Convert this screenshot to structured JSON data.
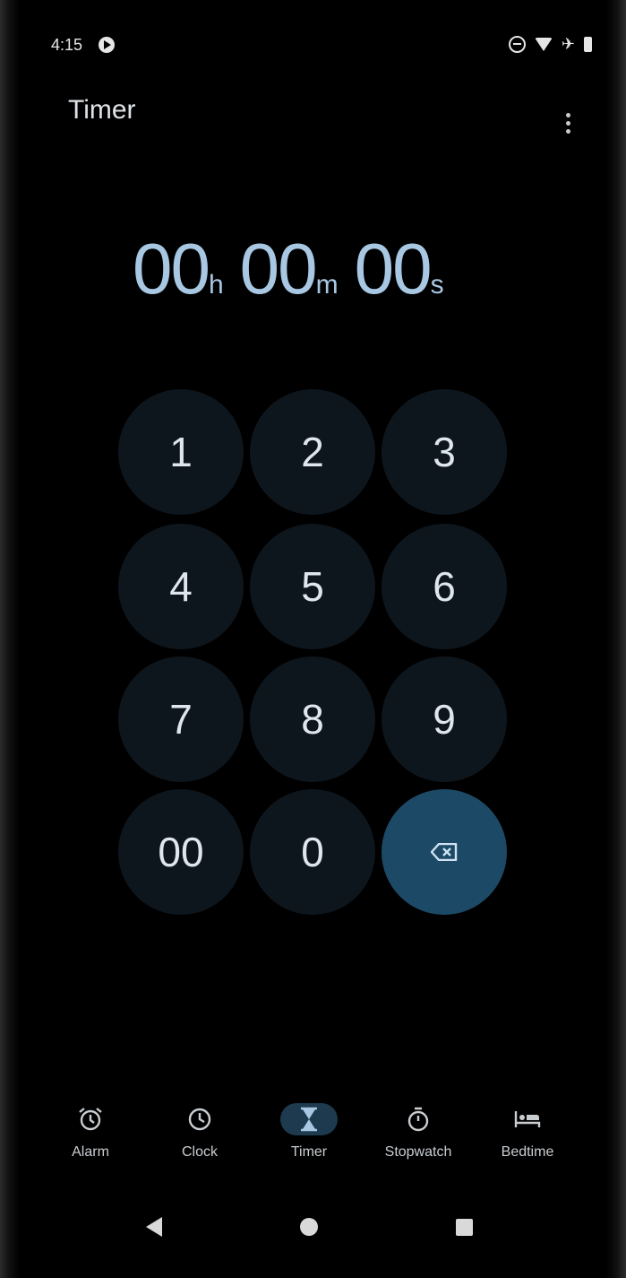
{
  "status_bar": {
    "time": "4:15"
  },
  "app": {
    "title": "Timer"
  },
  "readout": {
    "hours": "00",
    "hours_unit": "h",
    "minutes": "00",
    "minutes_unit": "m",
    "seconds": "00",
    "seconds_unit": "s"
  },
  "keypad": {
    "k1": "1",
    "k2": "2",
    "k3": "3",
    "k4": "4",
    "k5": "5",
    "k6": "6",
    "k7": "7",
    "k8": "8",
    "k9": "9",
    "k00": "00",
    "k0": "0",
    "delete_icon": "backspace-icon"
  },
  "tabs": [
    {
      "label": "Alarm",
      "icon": "alarm-clock-icon"
    },
    {
      "label": "Clock",
      "icon": "clock-icon"
    },
    {
      "label": "Timer",
      "icon": "hourglass-icon",
      "active": true
    },
    {
      "label": "Stopwatch",
      "icon": "stopwatch-icon"
    },
    {
      "label": "Bedtime",
      "icon": "bed-icon"
    }
  ],
  "colors": {
    "accent": "#a8c7e2",
    "delete_key": "#1c4a66",
    "active_tab": "#1d3a4e"
  }
}
